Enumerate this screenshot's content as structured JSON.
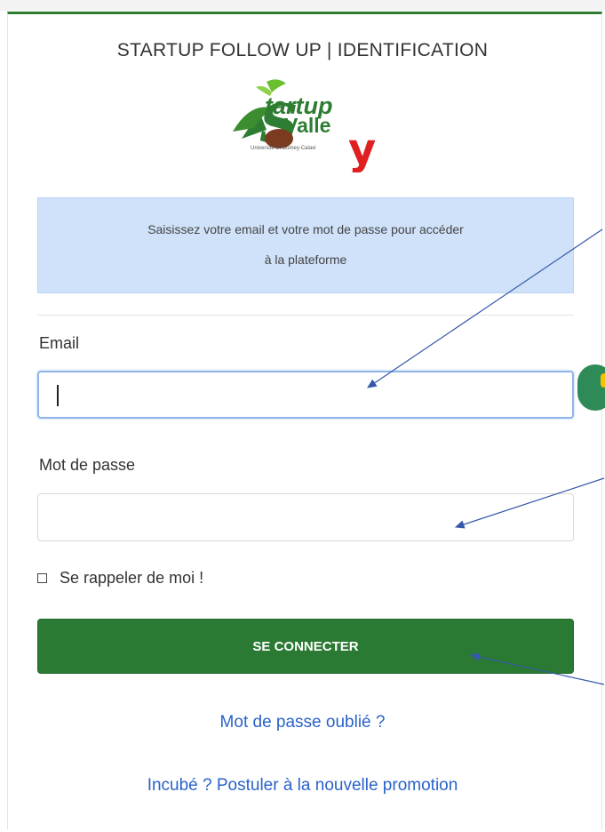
{
  "header": {
    "title": "STARTUP FOLLOW UP | IDENTIFICATION"
  },
  "logo": {
    "line1": "tartup",
    "line2": "Valle",
    "tagline": "Université d'Abomey-Calavi"
  },
  "alert": {
    "line1": "Saisissez votre email et votre mot de passe pour accéder",
    "line2": "à la plateforme"
  },
  "form": {
    "email_label": "Email",
    "email_value": "",
    "password_label": "Mot de passe",
    "password_value": "",
    "remember_label": "Se rappeler de moi !",
    "remember_checked": false,
    "submit_label": "SE CONNECTER"
  },
  "links": {
    "forgot_password": "Mot de passe oublié ?",
    "apply": "Incubé ? Postuler à la nouvelle promotion"
  },
  "colors": {
    "accent": "#2e7d32",
    "button": "#2b7a33",
    "link": "#2a62c9",
    "alert_bg": "#cfe2f9",
    "annotation_arrow": "#3558a8"
  }
}
